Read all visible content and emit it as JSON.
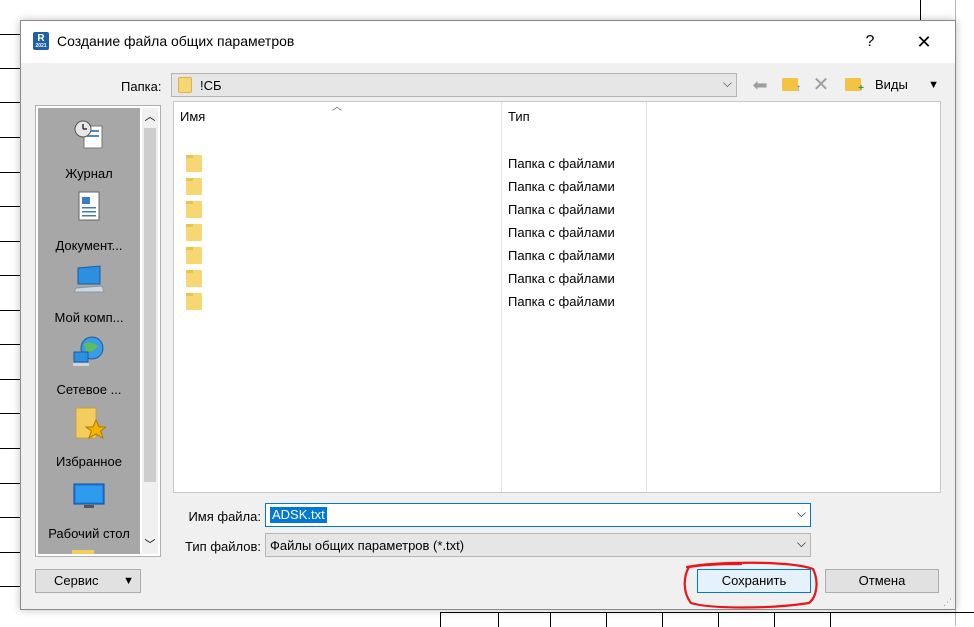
{
  "dialog": {
    "title": "Создание файла общих параметров",
    "app_icon_letter": "R",
    "app_icon_sub": "2021",
    "help_label": "?",
    "close_label": "✕"
  },
  "folder": {
    "label": "Папка:",
    "value": "!СБ"
  },
  "toolbar": {
    "views_label": "Виды"
  },
  "places": [
    {
      "label": "Журнал",
      "icon": "history-icon"
    },
    {
      "label": "Документ...",
      "icon": "documents-icon"
    },
    {
      "label": "Мой комп...",
      "icon": "my-computer-icon"
    },
    {
      "label": "Сетевое ...",
      "icon": "network-icon"
    },
    {
      "label": "Избранное",
      "icon": "favorites-icon"
    },
    {
      "label": "Рабочий стол",
      "icon": "desktop-icon"
    }
  ],
  "filelist": {
    "col_name": "Имя",
    "col_type": "Тип",
    "rows": [
      {
        "type": "Папка с файлами"
      },
      {
        "type": "Папка с файлами"
      },
      {
        "type": "Папка с файлами"
      },
      {
        "type": "Папка с файлами"
      },
      {
        "type": "Папка с файлами"
      },
      {
        "type": "Папка с файлами"
      },
      {
        "type": "Папка с файлами"
      }
    ]
  },
  "filename": {
    "label": "Имя файла:",
    "value": "ADSK.txt"
  },
  "filetype": {
    "label": "Тип файлов:",
    "value": "Файлы общих параметров (*.txt)"
  },
  "buttons": {
    "service": "Сервис",
    "save": "Сохранить",
    "cancel": "Отмена"
  },
  "colors": {
    "accent": "#0078d7",
    "highlight_circle": "#e8151b",
    "folder": "#f7d774"
  }
}
